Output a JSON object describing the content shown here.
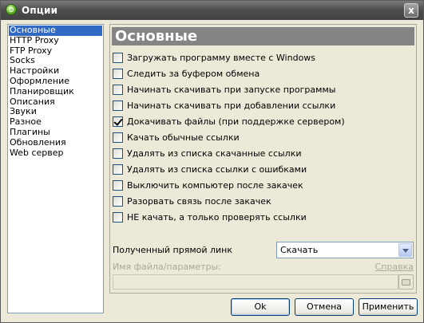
{
  "window": {
    "title": "Опции",
    "close_glyph": "x"
  },
  "sidebar": {
    "items": [
      {
        "label": "Основные",
        "selected": true
      },
      {
        "label": "HTTP Proxy"
      },
      {
        "label": "FTP Proxy"
      },
      {
        "label": "Socks"
      },
      {
        "label": "Настройки"
      },
      {
        "label": "Оформление"
      },
      {
        "label": "Планировщик"
      },
      {
        "label": "Описания"
      },
      {
        "label": "Звуки"
      },
      {
        "label": "Разное"
      },
      {
        "label": "Плагины"
      },
      {
        "label": "Обновления"
      },
      {
        "label": "Web сервер"
      }
    ]
  },
  "main": {
    "header": "Основные",
    "options": [
      {
        "label": "Загружать программу вместе с Windows",
        "checked": false
      },
      {
        "label": "Следить за буфером обмена",
        "checked": false
      },
      {
        "label": "Начинать скачивать при запуске программы",
        "checked": false
      },
      {
        "label": "Начинать скачивать при добавлении ссылки",
        "checked": false
      },
      {
        "label": "Докачивать файлы (при поддержке сервером)",
        "checked": true
      },
      {
        "label": "Качать обычные ссылки",
        "checked": false
      },
      {
        "label": "Удалять из списка скачанные ссылки",
        "checked": false
      },
      {
        "label": "Удалять из списка ссылки с ошибками",
        "checked": false
      },
      {
        "label": "Выключить компьютер после закачек",
        "checked": false
      },
      {
        "label": "Разорвать связь после закачек",
        "checked": false
      },
      {
        "label": "НЕ качать, а только проверять ссылки",
        "checked": false
      }
    ],
    "direct_link": {
      "label": "Полученный прямой линк",
      "selected_value": "Скачать"
    },
    "params": {
      "label": "Имя файла/параметры:",
      "help_link": "Справка",
      "value": ""
    }
  },
  "buttons": {
    "ok": "Ok",
    "cancel": "Отмена",
    "apply": "Применить"
  },
  "colors": {
    "selection": "#316ac5",
    "header_bg": "#848484",
    "window_bg": "#ece9d8"
  }
}
